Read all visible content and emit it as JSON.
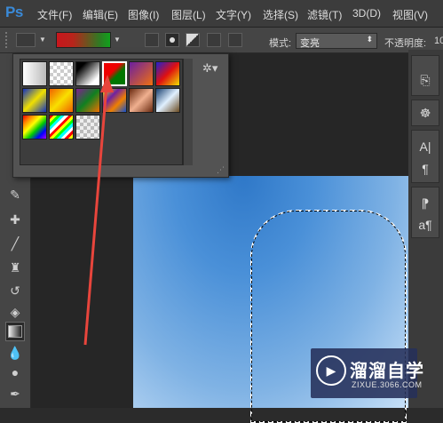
{
  "app": {
    "logo": "Ps"
  },
  "menu": [
    "文件(F)",
    "编辑(E)",
    "图像(I)",
    "图层(L)",
    "文字(Y)",
    "选择(S)",
    "滤镜(T)",
    "3D(D)",
    "视图(V)"
  ],
  "options_bar": {
    "mode_label": "模式:",
    "mode_value": "变亮",
    "opacity_label": "不透明度:",
    "opacity_value": "10"
  },
  "gradient_picker": {
    "gear_icon": "gear-icon",
    "swatches": [
      "foreground-to-background",
      "foreground-to-transparent",
      "black-to-white",
      "red-green",
      "violet-orange",
      "blue-red-yellow",
      "blue-yellow-blue",
      "orange-yellow-orange",
      "violet-green-orange",
      "yellow-violet-orange-blue",
      "copper",
      "chrome",
      "spectrum",
      "transparent-rainbow",
      "transparent-stripes"
    ],
    "selected_index": 3
  },
  "toolbox_icons": [
    "eyedropper-icon",
    "healing-brush-icon",
    "brush-icon",
    "clone-stamp-icon",
    "history-brush-icon",
    "eraser-icon",
    "gradient-icon",
    "blur-icon",
    "dodge-icon",
    "pen-icon"
  ],
  "panel_icons": [
    "history-icon",
    "navigator-icon",
    "character-icon",
    "paragraph-icon",
    "paragraph-styles-icon",
    "character-styles-icon"
  ],
  "watermark": {
    "title": "溜溜自学",
    "subtitle": "ZIXUE.3066.COM"
  },
  "colors": {
    "accent": "#3a8ad8",
    "arrow": "#e8453c",
    "canvas_top": "#2f78c8",
    "canvas_bottom": "#c8e0f7"
  }
}
